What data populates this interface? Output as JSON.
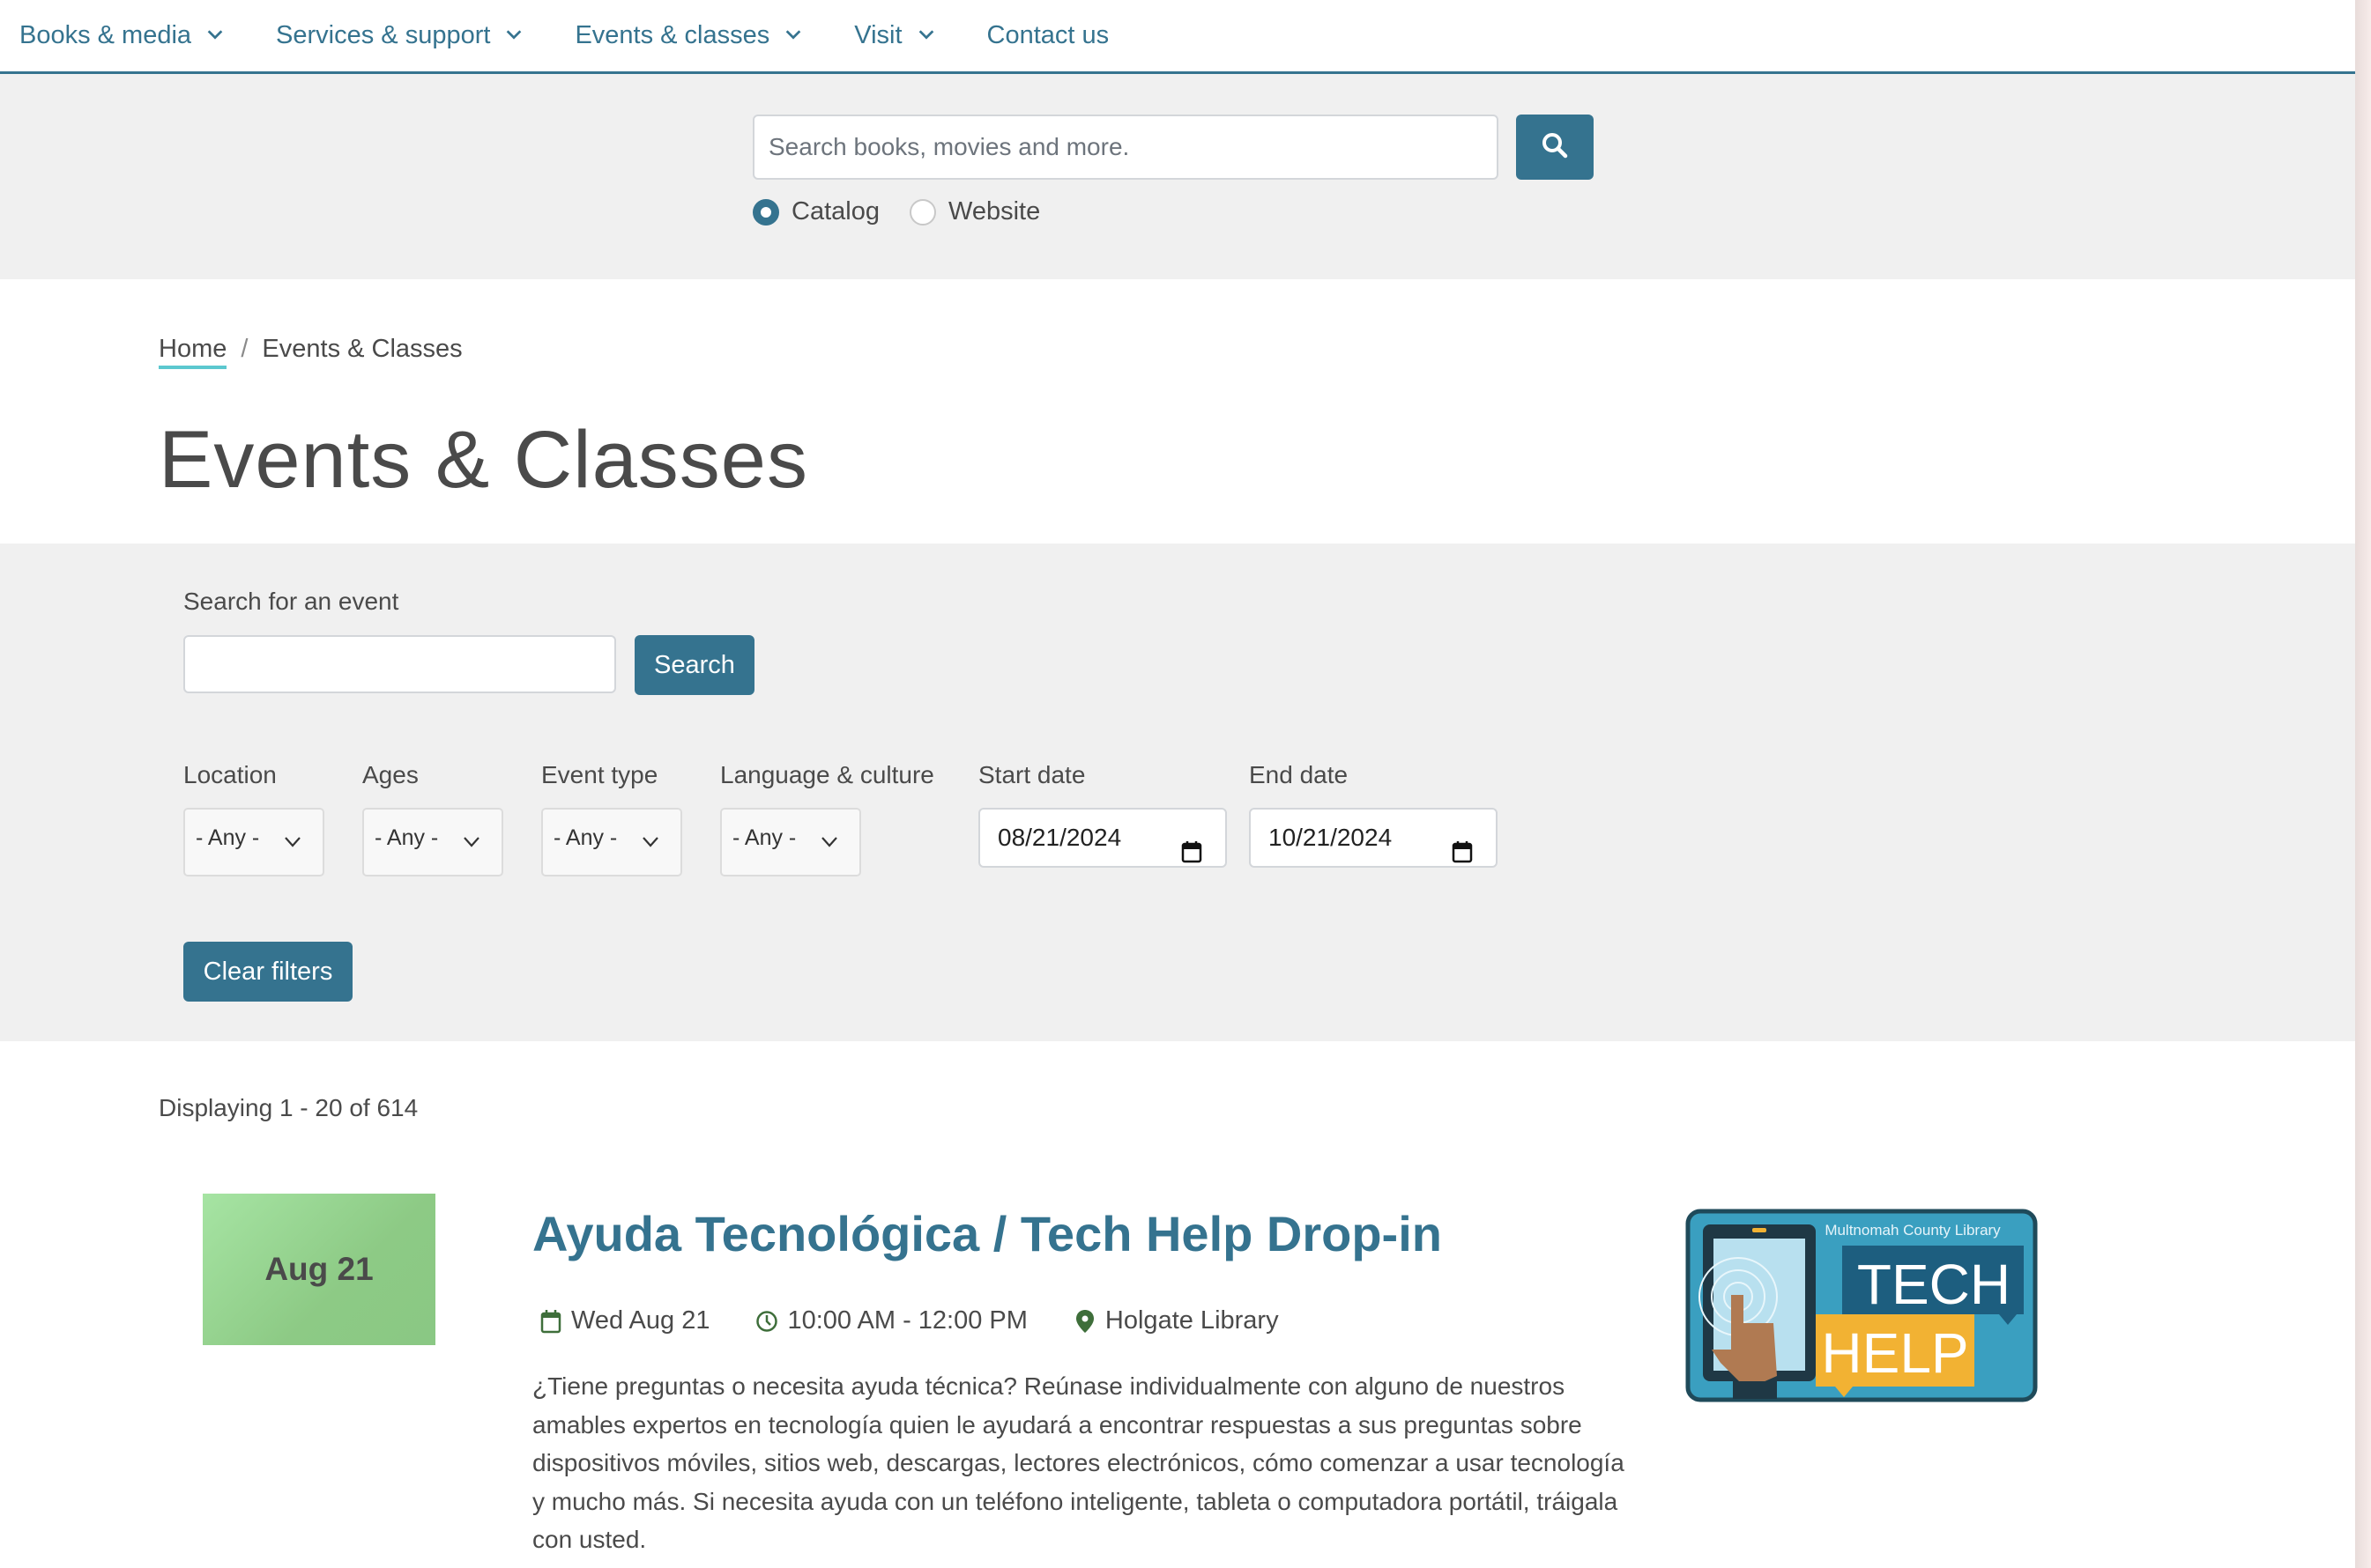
{
  "nav": {
    "items": [
      {
        "label": "Books & media",
        "has_dropdown": true
      },
      {
        "label": "Services & support",
        "has_dropdown": true
      },
      {
        "label": "Events & classes",
        "has_dropdown": true
      },
      {
        "label": "Visit",
        "has_dropdown": true
      },
      {
        "label": "Contact us",
        "has_dropdown": false
      }
    ]
  },
  "catalog_search": {
    "placeholder": "Search books, movies and more.",
    "value": "",
    "button_icon": "search-icon",
    "scope_options": [
      {
        "label": "Catalog",
        "selected": true
      },
      {
        "label": "Website",
        "selected": false
      }
    ]
  },
  "breadcrumb": {
    "home": "Home",
    "separator": "/",
    "current": "Events & Classes"
  },
  "page_title": "Events & Classes",
  "filters": {
    "search_label": "Search for an event",
    "search_value": "",
    "search_button": "Search",
    "selects": [
      {
        "label": "Location",
        "value": "- Any -"
      },
      {
        "label": "Ages",
        "value": "- Any -"
      },
      {
        "label": "Event type",
        "value": "- Any -"
      },
      {
        "label": "Language & culture",
        "value": "- Any -"
      }
    ],
    "start_date": {
      "label": "Start date",
      "value": "08/21/2024"
    },
    "end_date": {
      "label": "End date",
      "value": "10/21/2024"
    },
    "clear_button": "Clear filters"
  },
  "results": {
    "count_text": "Displaying 1 - 20 of 614",
    "events": [
      {
        "badge_date": "Aug 21",
        "title": "Ayuda Tecnológica / Tech Help Drop-in",
        "date": "Wed Aug 21",
        "time": "10:00 AM - 12:00 PM",
        "location": "Holgate Library",
        "description": "¿Tiene preguntas o necesita ayuda técnica? Reúnase individualmente con alguno de nuestros amables expertos en tecnología quien le ayudará a encontrar respuestas a sus preguntas sobre dispositivos móviles, sitios web, descargas, lectores electrónicos, cómo comenzar a usar tecnología y mucho más. Si necesita ayuda con un teléfono inteligente, tableta o computadora portátil, tráigala con usted.",
        "image": {
          "org_text": "Multnomah County Library",
          "line1": "TECH",
          "line2": "HELP"
        }
      }
    ]
  },
  "colors": {
    "brand": "#35738f",
    "accent_underline": "#5cc8cf",
    "meta_icon": "#3e6e3a",
    "badge_green": "#96d690",
    "panel_bg": "#f0f0f0",
    "text": "#4a4a4a"
  }
}
